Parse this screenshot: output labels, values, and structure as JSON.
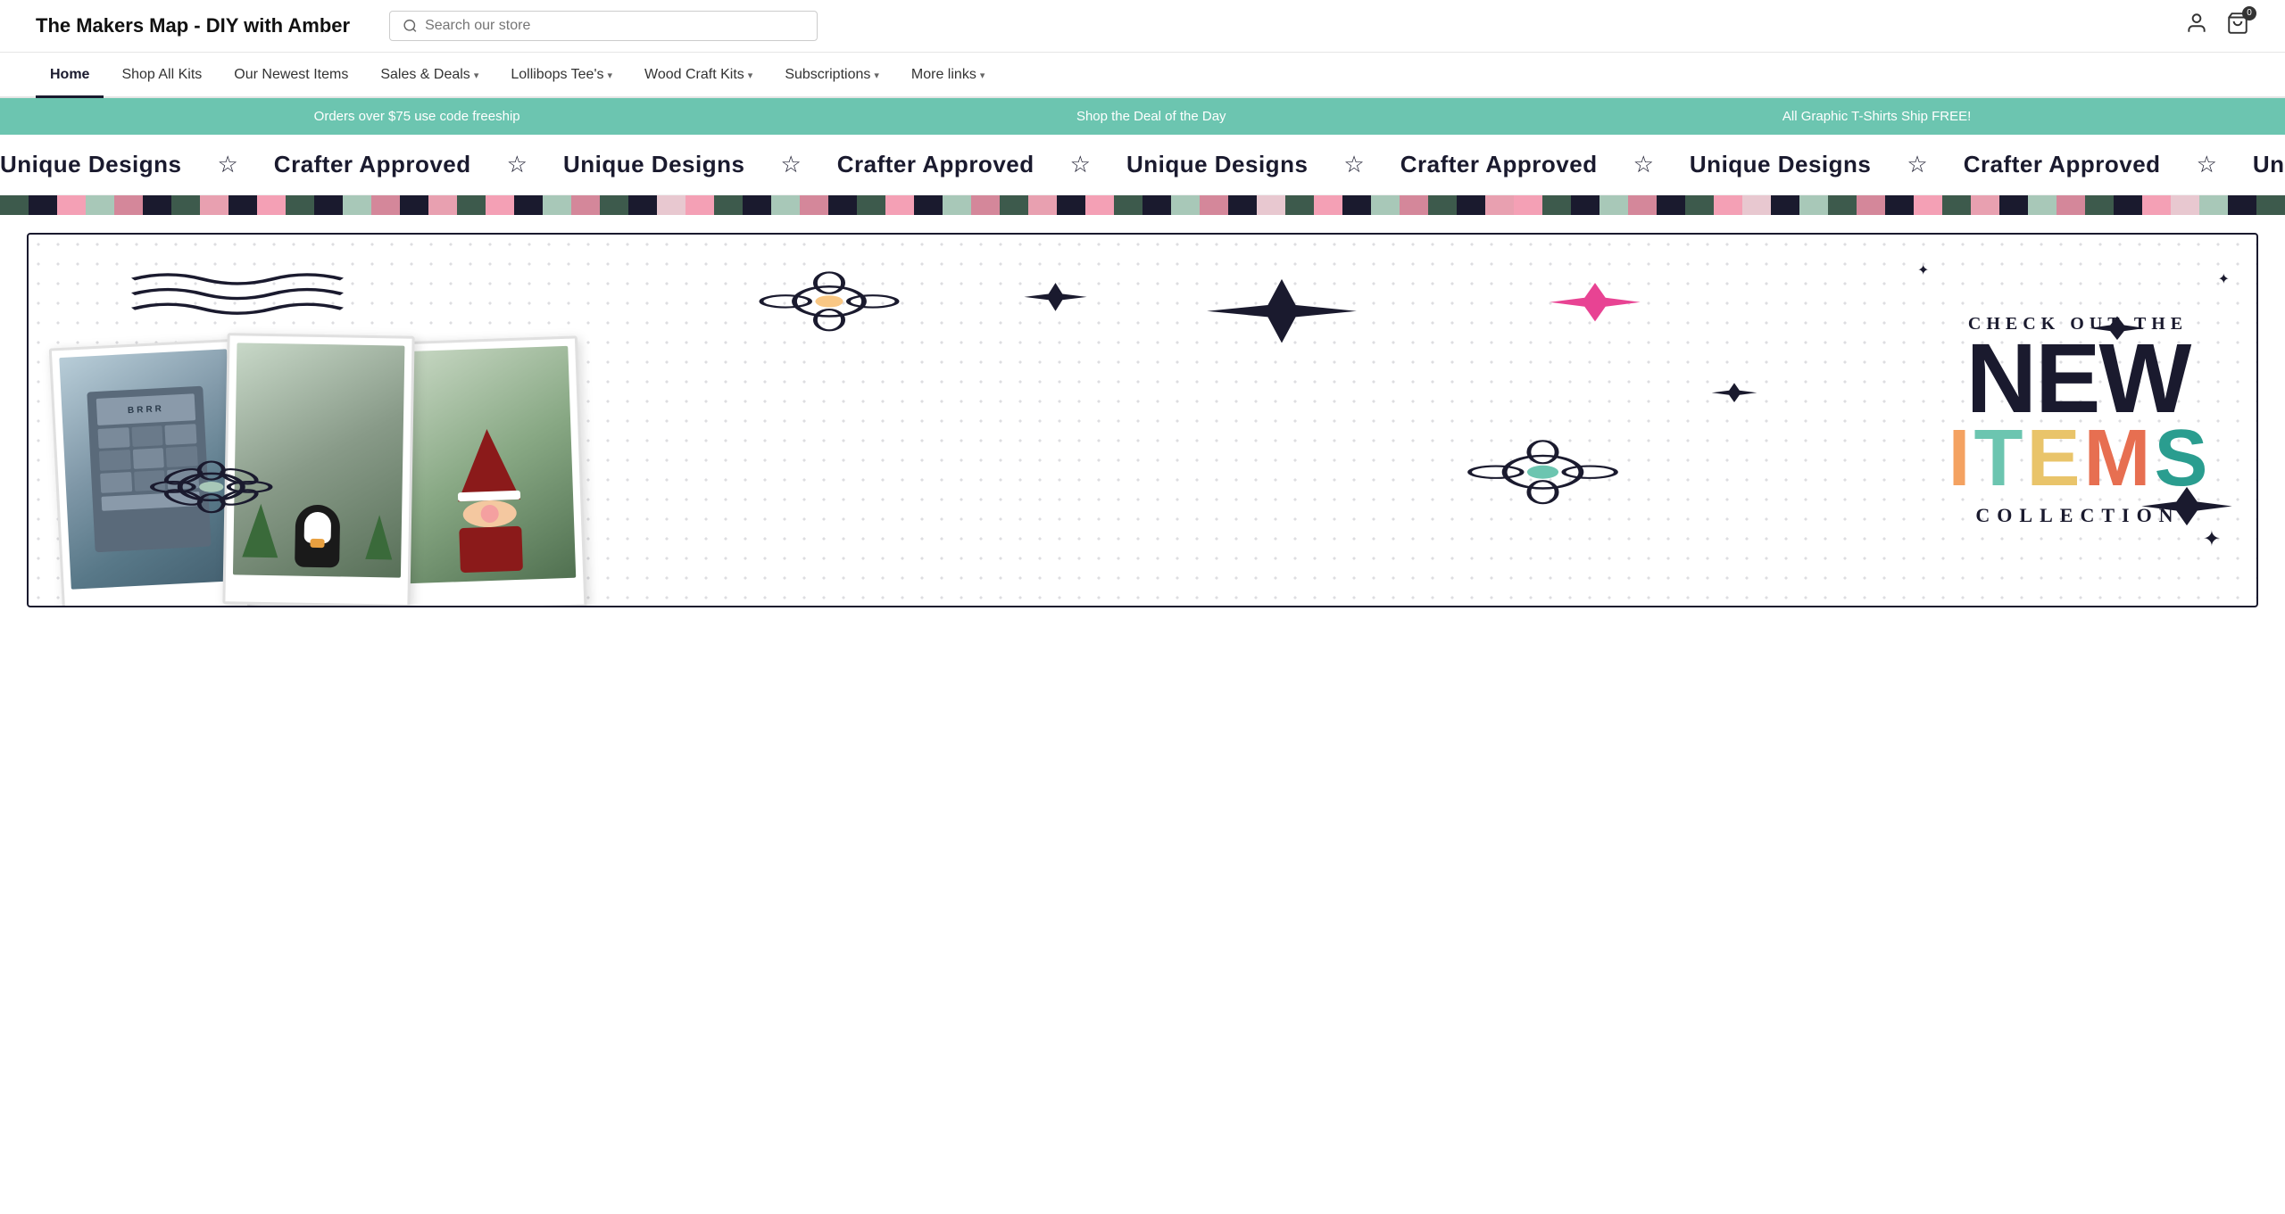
{
  "header": {
    "logo": "The Makers Map - DIY with Amber",
    "search_placeholder": "Search our store",
    "cart_count": "0"
  },
  "nav": {
    "items": [
      {
        "label": "Home",
        "active": true,
        "has_dropdown": false
      },
      {
        "label": "Shop All Kits",
        "active": false,
        "has_dropdown": false
      },
      {
        "label": "Our Newest Items",
        "active": false,
        "has_dropdown": false
      },
      {
        "label": "Sales & Deals",
        "active": false,
        "has_dropdown": true
      },
      {
        "label": "Lollibops Tee's",
        "active": false,
        "has_dropdown": true
      },
      {
        "label": "Wood Craft Kits",
        "active": false,
        "has_dropdown": true
      },
      {
        "label": "Subscriptions",
        "active": false,
        "has_dropdown": true
      },
      {
        "label": "More links",
        "active": false,
        "has_dropdown": true
      }
    ]
  },
  "announcement": {
    "items": [
      "Orders over $75 use code freeship",
      "Shop the Deal of the Day",
      "All Graphic T-Shirts Ship FREE!"
    ]
  },
  "marquee": {
    "items": [
      "Unique Designs",
      "Crafter Approved",
      "Unique Designs",
      "Crafter Approved",
      "Unique Designs",
      "Crafter Approved",
      "Unique Designs",
      "Crafter Approved"
    ]
  },
  "hero": {
    "check_out": "CHECK OUT THE",
    "new": "NEW",
    "items_letters": [
      "I",
      "T",
      "E",
      "M",
      "S"
    ],
    "collection": "COLLECTION"
  },
  "color_bar": {
    "colors": [
      "#3d5a4c",
      "#1a1a2e",
      "#f4a0b5",
      "#a8c8b8",
      "#d4879a",
      "#1a1a2e",
      "#3d5a4c",
      "#e8a0b0",
      "#1a1a2e",
      "#f4a0b5",
      "#3d5a4c",
      "#1a1a2e",
      "#a8c8b8",
      "#d4879a",
      "#1a1a2e",
      "#e8a0b0",
      "#3d5a4c",
      "#f4a0b5",
      "#1a1a2e",
      "#a8c8b8",
      "#d4879a",
      "#3d5a4c",
      "#1a1a2e",
      "#e8c8d0",
      "#f4a0b5",
      "#3d5a4c",
      "#1a1a2e",
      "#a8c8b8",
      "#d4879a",
      "#1a1a2e",
      "#3d5a4c",
      "#f4a0b5",
      "#1a1a2e",
      "#a8c8b8",
      "#d4879a",
      "#3d5a4c",
      "#e8a0b0",
      "#1a1a2e",
      "#f4a0b5",
      "#3d5a4c",
      "#1a1a2e",
      "#a8c8b8",
      "#d4879a",
      "#1a1a2e",
      "#e8c8d0",
      "#3d5a4c",
      "#f4a0b5",
      "#1a1a2e",
      "#a8c8b8",
      "#d4879a",
      "#3d5a4c",
      "#1a1a2e",
      "#e8a0b0",
      "#f4a0b5",
      "#3d5a4c",
      "#1a1a2e",
      "#a8c8b8",
      "#d4879a",
      "#1a1a2e",
      "#3d5a4c",
      "#f4a0b5",
      "#e8c8d0",
      "#1a1a2e",
      "#a8c8b8",
      "#3d5a4c",
      "#d4879a",
      "#1a1a2e",
      "#f4a0b5",
      "#3d5a4c",
      "#e8a0b0",
      "#1a1a2e",
      "#a8c8b8",
      "#d4879a",
      "#3d5a4c",
      "#1a1a2e",
      "#f4a0b5",
      "#e8c8d0",
      "#a8c8b8",
      "#1a1a2e",
      "#3d5a4c"
    ]
  }
}
